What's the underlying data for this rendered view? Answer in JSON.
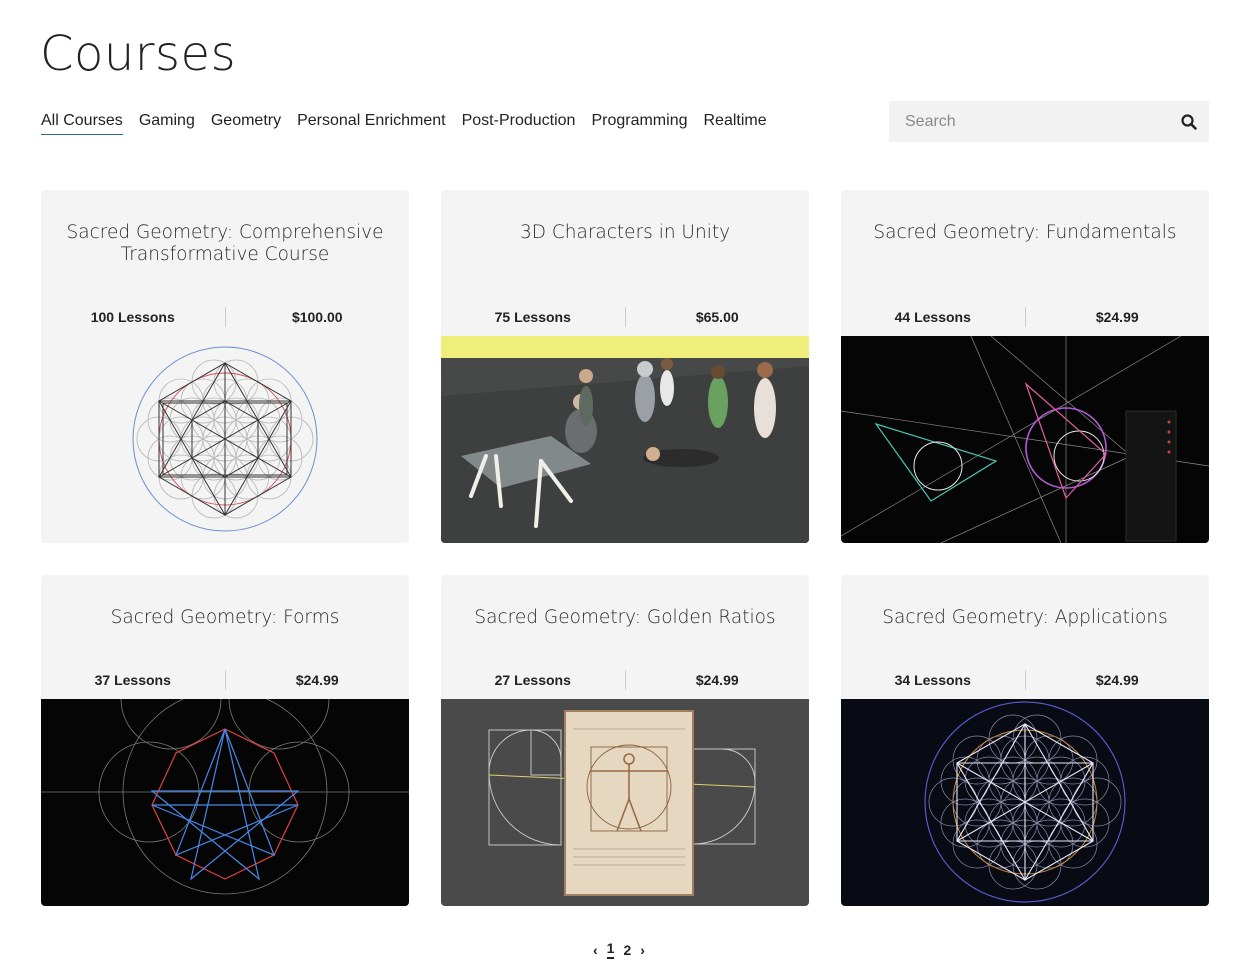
{
  "page": {
    "title": "Courses"
  },
  "filters": [
    "All Courses",
    "Gaming",
    "Geometry",
    "Personal Enrichment",
    "Post-Production",
    "Programming",
    "Realtime"
  ],
  "search": {
    "placeholder": "Search",
    "value": ""
  },
  "courses": [
    {
      "title": "Sacred Geometry: Comprehensive Transformative Course",
      "lessons": "100 Lessons",
      "price": "$100.00",
      "image": "metatron-cube-light"
    },
    {
      "title": "3D Characters in Unity",
      "lessons": "75 Lessons",
      "price": "$65.00",
      "image": "unity-characters-scene"
    },
    {
      "title": "Sacred Geometry: Fundamentals",
      "lessons": "44 Lessons",
      "price": "$24.99",
      "image": "geometry-construction-dark"
    },
    {
      "title": "Sacred Geometry: Forms",
      "lessons": "37 Lessons",
      "price": "$24.99",
      "image": "heptagram-dark"
    },
    {
      "title": "Sacred Geometry: Golden Ratios",
      "lessons": "27 Lessons",
      "price": "$24.99",
      "image": "vitruvian-golden-spiral"
    },
    {
      "title": "Sacred Geometry: Applications",
      "lessons": "34 Lessons",
      "price": "$24.99",
      "image": "flower-of-life-dark"
    }
  ],
  "pagination": {
    "prev": "‹",
    "pages": [
      "1",
      "2"
    ],
    "current": "1",
    "next": "›"
  },
  "colors": {
    "accent": "#2a6a8a",
    "card_bg": "#f4f4f4",
    "search_bg": "#f2f2f2"
  }
}
